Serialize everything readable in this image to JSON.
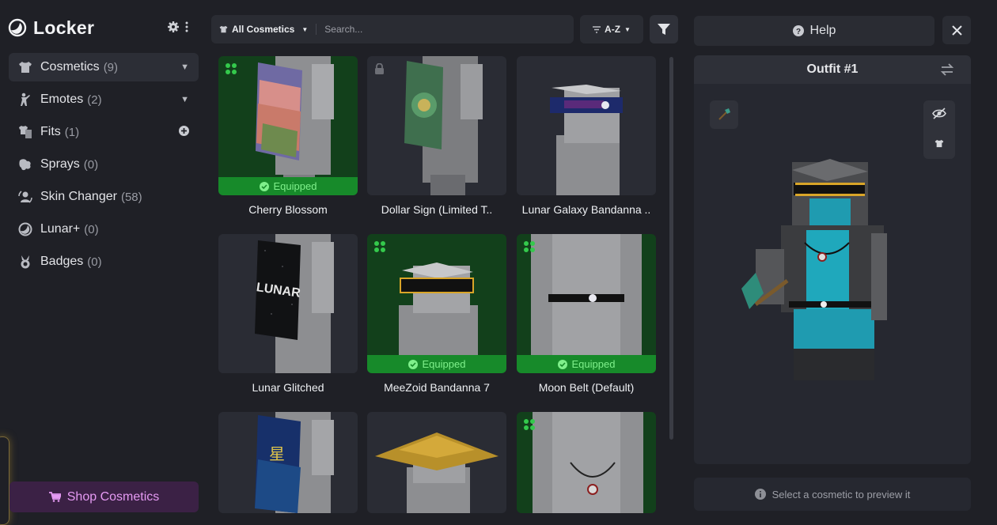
{
  "app": {
    "title": "Locker"
  },
  "sidebar": {
    "items": [
      {
        "label": "Cosmetics",
        "count": "(9)",
        "icon": "shirt-icon"
      },
      {
        "label": "Emotes",
        "count": "(2)",
        "icon": "emote-icon"
      },
      {
        "label": "Fits",
        "count": "(1)",
        "icon": "fits-icon"
      },
      {
        "label": "Sprays",
        "count": "(0)",
        "icon": "spray-icon"
      },
      {
        "label": "Skin Changer",
        "count": "(58)",
        "icon": "skin-changer-icon"
      },
      {
        "label": "Lunar+",
        "count": "(0)",
        "icon": "lunar-plus-icon"
      },
      {
        "label": "Badges",
        "count": "(0)",
        "icon": "badge-icon"
      }
    ],
    "shop_label": "Shop Cosmetics"
  },
  "toolbar": {
    "category": "All Cosmetics",
    "search_placeholder": "Search...",
    "sort": "A-Z"
  },
  "cosmetics": [
    {
      "name": "Cherry Blossom",
      "equipped": true
    },
    {
      "name": "Dollar Sign (Limited T..",
      "equipped": false
    },
    {
      "name": "Lunar Galaxy Bandanna ..",
      "equipped": false
    },
    {
      "name": "Lunar Glitched",
      "equipped": false
    },
    {
      "name": "MeeZoid Bandanna 7",
      "equipped": true
    },
    {
      "name": "Moon Belt (Default)",
      "equipped": true
    }
  ],
  "equipped_label": "Equipped",
  "cape_text": "LUNAR",
  "cape_text2": "星",
  "panel": {
    "help_label": "Help",
    "outfit_title": "Outfit #1",
    "preview_hint": "Select a cosmetic to preview it"
  },
  "colors": {
    "accent_green": "#178a2a",
    "shop": "#e59af3",
    "bg": "#1f2026"
  }
}
